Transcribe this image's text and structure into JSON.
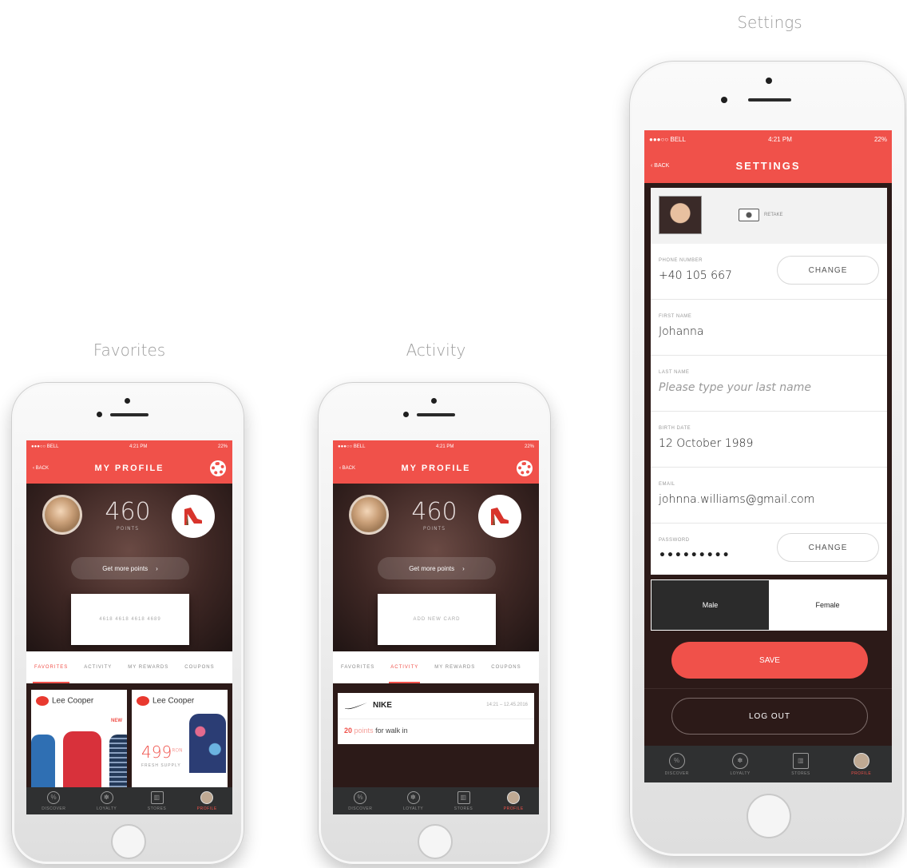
{
  "captions": {
    "favorites": "Favorites",
    "activity": "Activity",
    "settings": "Settings"
  },
  "status": {
    "carrier": "●●●○○ BELL ",
    "time": "4:21 PM",
    "battery": "22%"
  },
  "colors": {
    "accent": "#f0514a",
    "tabbar": "#2f3031",
    "hero_dark": "#2c1a18"
  },
  "profile": {
    "back": "‹ BACK",
    "title": "MY PROFILE",
    "points_value": "460",
    "points_label": "POINTS",
    "more_points": "Get more points",
    "more_chevron": "›",
    "card_number": "4618 4618 4618 4689",
    "add_card": "ADD NEW CARD",
    "gear_icon": "gear-icon"
  },
  "profile_tabs": [
    "FAVORITES",
    "ACTIVITY",
    "MY REWARDS",
    "COUPONS"
  ],
  "favorites": {
    "brand1": "Lee Cooper",
    "brand2": "Lee Cooper",
    "new_badge": "NEW",
    "price": "499",
    "price_sup": "RON",
    "price_tag": "FRESH SUPPLY"
  },
  "activity": {
    "brand": "NIKE",
    "time": "14:21 – 12.45.2016",
    "points": "20",
    "points_word": "points",
    "text": "for walk in"
  },
  "tabbar": [
    {
      "label": "DISCOVER",
      "icon": "discount-icon",
      "glyph": "%"
    },
    {
      "label": "LOYALTY",
      "icon": "loyalty-icon",
      "glyph": "✽"
    },
    {
      "label": "STORES",
      "icon": "map-icon",
      "glyph": "▥"
    },
    {
      "label": "PROFILE",
      "icon": "profile-icon",
      "glyph": "●"
    }
  ],
  "settings": {
    "back": "‹ BACK",
    "title": "SETTINGS",
    "retake": "RETAKE",
    "phone_label": "PHONE NUMBER",
    "phone_value": "+40 105 667",
    "change": "CHANGE",
    "first_label": "FIRST NAME",
    "first_value": "Johanna",
    "last_label": "LAST NAME",
    "last_placeholder": "Please type your last name",
    "birth_label": "BIRTH DATE",
    "birth_value": "12 October 1989",
    "email_label": "EMAIL",
    "email_value": "johnna.williams@gmail.com",
    "password_label": "PASSWORD",
    "password_value": "•••••••••",
    "change2": "CHANGE",
    "male": "Male",
    "female": "Female",
    "save": "SAVE",
    "logout": "LOG OUT"
  }
}
